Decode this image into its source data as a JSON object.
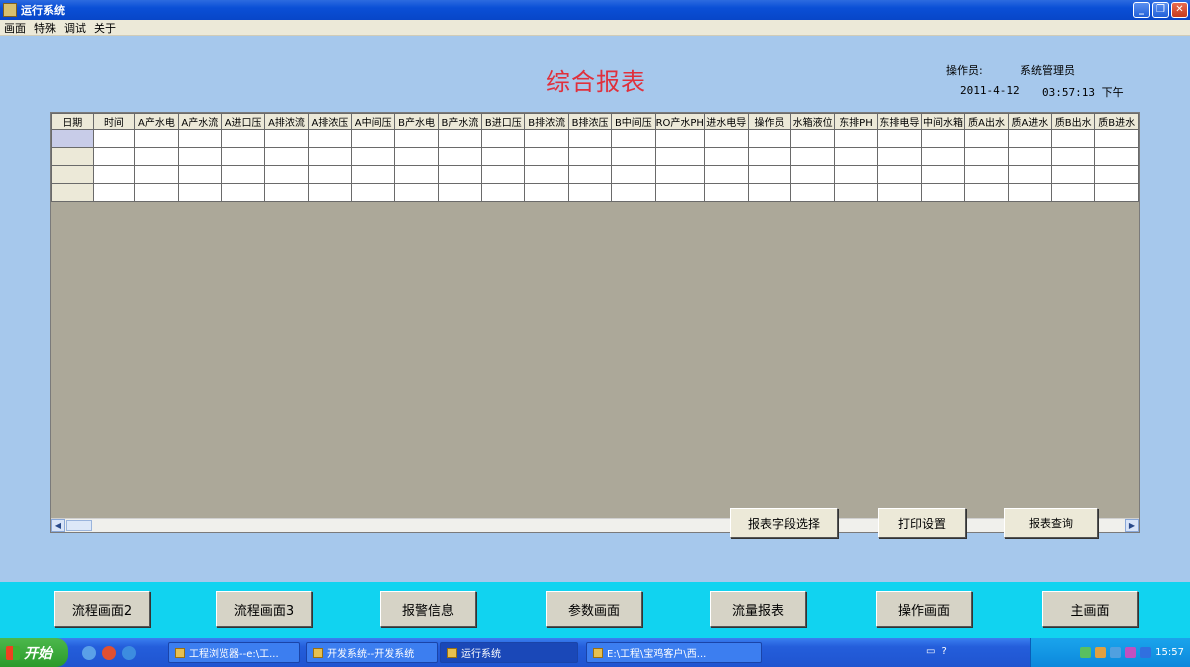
{
  "window": {
    "title": "运行系统"
  },
  "menu": [
    "画面",
    "特殊",
    "调试",
    "关于"
  ],
  "report": {
    "title": "综合报表",
    "operator_label": "操作员:",
    "operator_name": "系统管理员",
    "date": "2011-4-12",
    "time": "03:57:13 下午"
  },
  "grid": {
    "columns": [
      "日期",
      "时间",
      "A产水电",
      "A产水流",
      "A进口压",
      "A排浓流",
      "A排浓压",
      "A中间压",
      "B产水电",
      "B产水流",
      "B进口压",
      "B排浓流",
      "B排浓压",
      "B中间压",
      "RO产水PH",
      "进水电导",
      "操作员",
      "水箱液位",
      "东排PH",
      "东排电导",
      "中间水箱",
      "质A出水",
      "质A进水",
      "质B出水",
      "质B进水"
    ],
    "row_count": 4
  },
  "actions": {
    "field_select": "报表字段选择",
    "print_setup": "打印设置",
    "query": "报表查询"
  },
  "nav": [
    "流程画面2",
    "流程画面3",
    "报警信息",
    "参数画面",
    "流量报表",
    "操作画面",
    "主画面"
  ],
  "taskbar": {
    "start": "开始",
    "tasks": [
      "工程浏览器--e:\\工...",
      "开发系统--开发系统",
      "运行系统",
      "E:\\工程\\宝鸡客户\\西..."
    ],
    "clock": "15:57"
  }
}
